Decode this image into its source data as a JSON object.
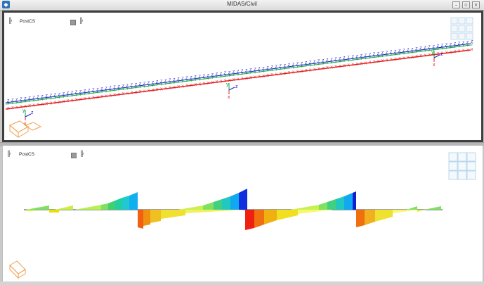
{
  "window": {
    "title": "MIDAS/Civil",
    "app_icon": "midas-logo-icon",
    "controls": [
      "minimize-icon",
      "restore-icon",
      "close-icon"
    ]
  },
  "views": [
    {
      "coord_label": "PostCS",
      "content": "3d-beam-model",
      "axes": [
        "y",
        "z",
        "x"
      ]
    },
    {
      "coord_label": "PostCS",
      "content": "shear-force-diagram"
    }
  ],
  "icons": {
    "view_cube": "view-cube-icon",
    "stage_icon": "stage-icon",
    "orientation": "orientation-box-icon"
  },
  "colors": {
    "beam_red": "#e02020",
    "beam_blue": "#1818d0",
    "beam_green": "#10a040",
    "ucs_orange": "#f0a050"
  },
  "model_labels": {
    "beam_marks": [
      "Z",
      "Y",
      "X"
    ]
  }
}
